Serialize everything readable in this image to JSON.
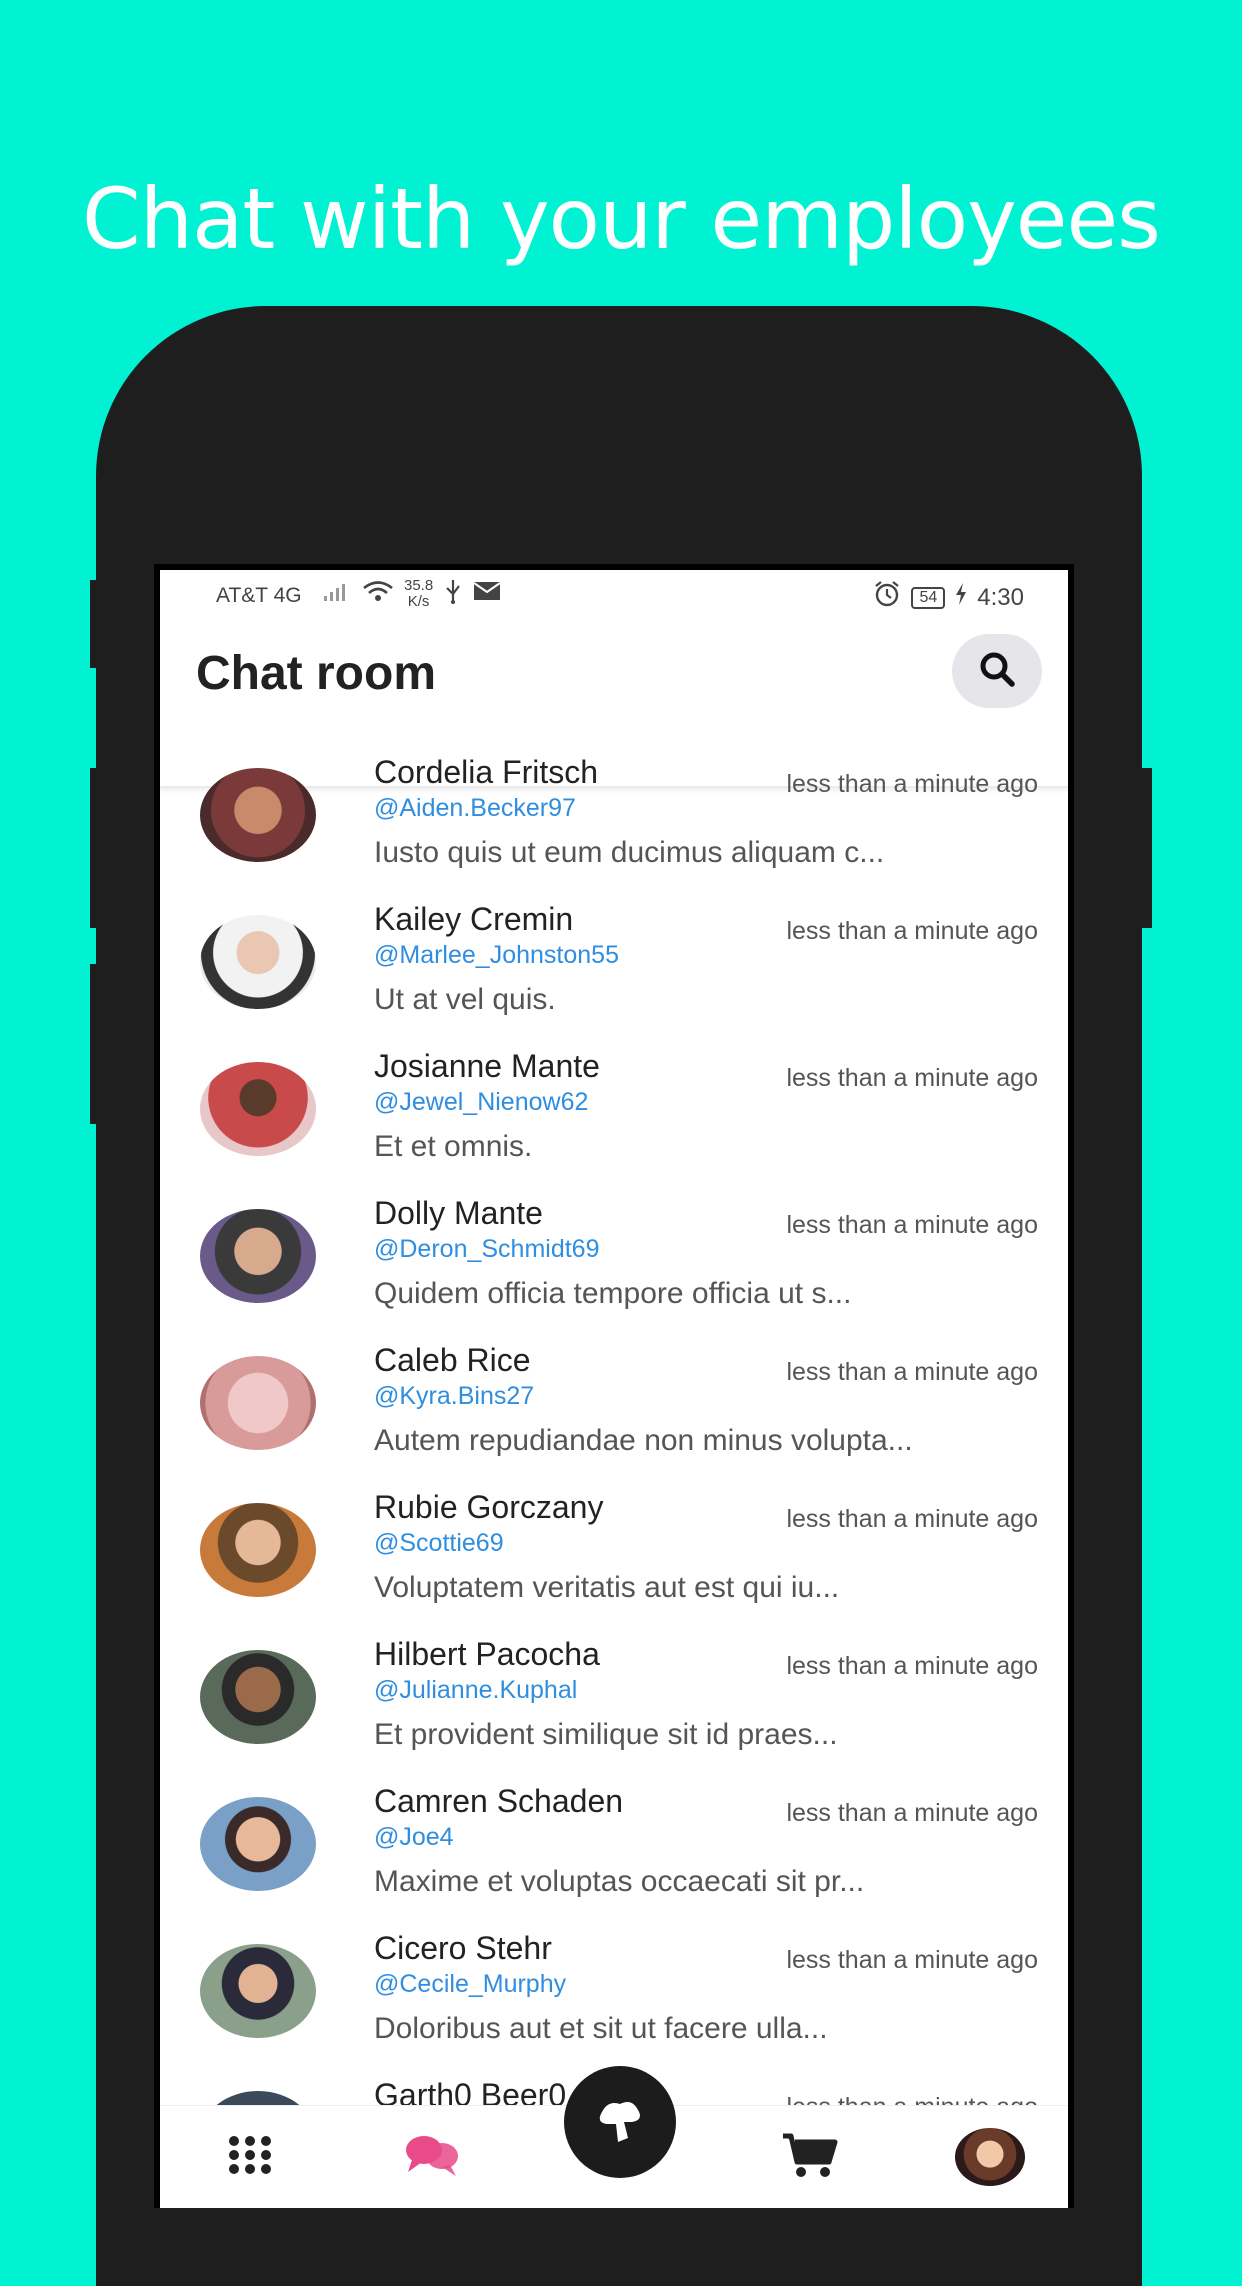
{
  "headline": "Chat with your employees",
  "status_bar": {
    "carrier": "AT&T 4G",
    "speed_value": "35.8",
    "speed_unit": "K/s",
    "battery": "54",
    "time": "4:30"
  },
  "app_bar": {
    "title": "Chat room"
  },
  "chats": [
    {
      "name": "Cordelia Fritsch",
      "handle": "@Aiden.Becker97",
      "time": "less than a minute ago",
      "message": "Iusto quis ut eum ducimus aliquam c..."
    },
    {
      "name": "Kailey Cremin",
      "handle": "@Marlee_Johnston55",
      "time": "less than a minute ago",
      "message": "Ut at vel quis."
    },
    {
      "name": "Josianne Mante",
      "handle": "@Jewel_Nienow62",
      "time": "less than a minute ago",
      "message": "Et et omnis."
    },
    {
      "name": "Dolly Mante",
      "handle": "@Deron_Schmidt69",
      "time": "less than a minute ago",
      "message": "Quidem officia tempore officia ut s..."
    },
    {
      "name": "Caleb Rice",
      "handle": "@Kyra.Bins27",
      "time": "less than a minute ago",
      "message": "Autem repudiandae non minus volupta..."
    },
    {
      "name": "Rubie Gorczany",
      "handle": "@Scottie69",
      "time": "less than a minute ago",
      "message": "Voluptatem veritatis aut est qui iu..."
    },
    {
      "name": "Hilbert Pacocha",
      "handle": "@Julianne.Kuphal",
      "time": "less than a minute ago",
      "message": "Et provident similique sit id praes..."
    },
    {
      "name": "Camren Schaden",
      "handle": "@Joe4",
      "time": "less than a minute ago",
      "message": "Maxime et voluptas occaecati sit pr..."
    },
    {
      "name": "Cicero Stehr",
      "handle": "@Cecile_Murphy",
      "time": "less than a minute ago",
      "message": "Doloribus aut et sit ut facere ulla..."
    },
    {
      "name": "Garth0 Beer0",
      "handle": "",
      "time": "less than a minute ago",
      "message": ""
    }
  ],
  "colors": {
    "background": "#00F2D2",
    "phone_frame": "#1e1e1e",
    "handle": "#2f8ee0",
    "chat_icon": "#e84a8a"
  },
  "bottom_nav": {
    "items": [
      "grid-icon",
      "chat-bubbles-icon",
      "home-center-icon",
      "cart-icon",
      "profile-avatar"
    ]
  }
}
